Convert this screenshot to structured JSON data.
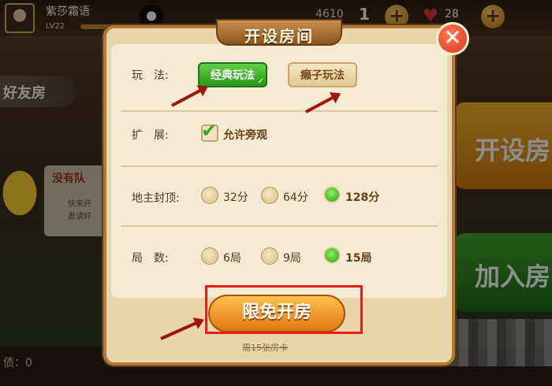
{
  "background": {
    "player": {
      "name": "紫莎霜语",
      "level": "LV22"
    },
    "currency": {
      "coins": "4610",
      "gems": "1",
      "hearts": "28"
    },
    "left": {
      "friend_room_label": "好友房",
      "invite_title": "没有队",
      "invite_line1": "快来开",
      "invite_line2": "邀请好"
    },
    "right": {
      "create_label": "开设房",
      "join_label": "加入房"
    },
    "bottom": {
      "stat_label": "债：0"
    }
  },
  "dialog": {
    "title": "开设房间",
    "close_glyph": "✕",
    "mode": {
      "label": "玩　法:",
      "options": [
        {
          "label": "经典玩法",
          "selected": true
        },
        {
          "label": "癞子玩法",
          "selected": false
        }
      ]
    },
    "extend": {
      "label": "扩　展:",
      "allow_spectate": "允许旁观",
      "checked": true
    },
    "cap": {
      "label": "地主封顶:",
      "options": [
        {
          "label": "32分",
          "selected": false
        },
        {
          "label": "64分",
          "selected": false
        },
        {
          "label": "128分",
          "selected": true
        }
      ]
    },
    "rounds": {
      "label": "局　数:",
      "options": [
        {
          "label": "6局",
          "selected": false
        },
        {
          "label": "9局",
          "selected": false
        },
        {
          "label": "15局",
          "selected": true
        }
      ]
    },
    "create_button": "限免开房",
    "cost_note": "需15张房卡"
  },
  "colors": {
    "annotation_red": "#e81e1e",
    "arrow": "#a0140c",
    "selected_green": "#2f9a1a"
  }
}
